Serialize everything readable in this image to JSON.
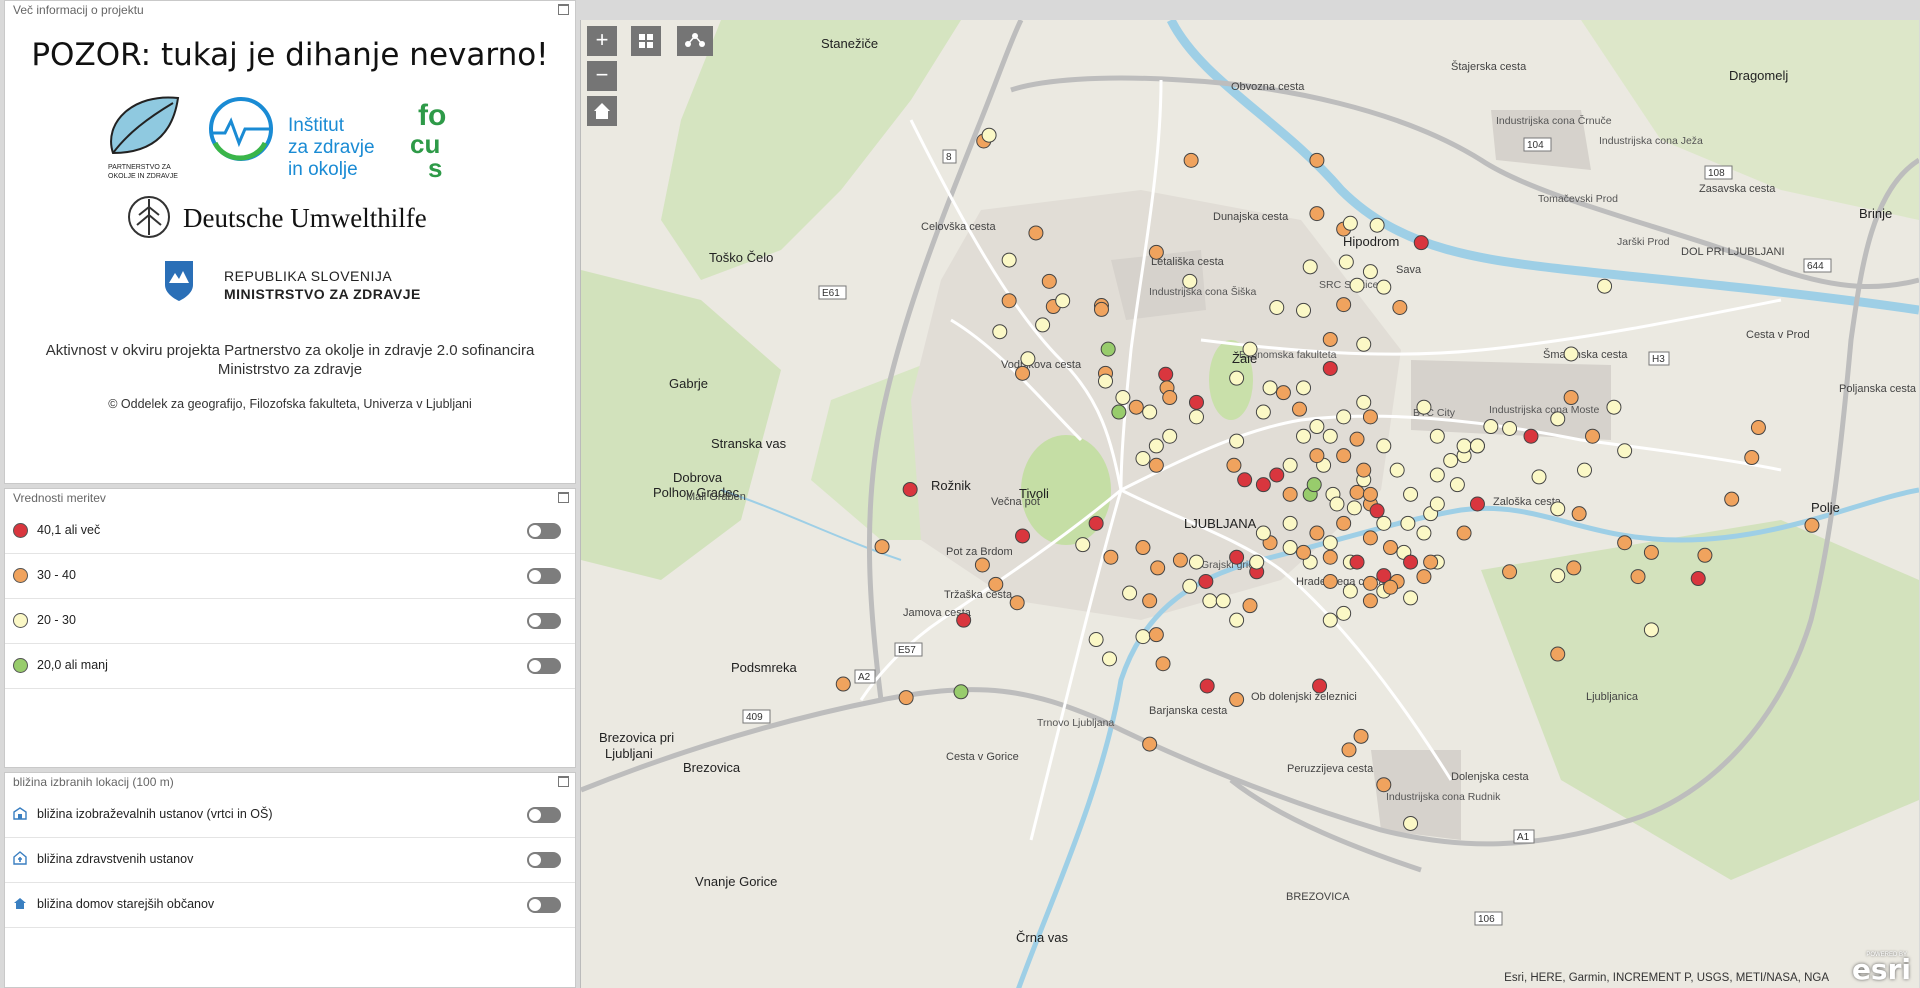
{
  "panel_info": {
    "title": "Več informacij o projektu",
    "headline": "POZOR: tukaj je dihanje nevarno!",
    "logo_pzz": "PARTNERSTVO ZA OKOLJE IN ZDRAVJE",
    "logo_izo": [
      "Inštitut",
      "za zdravje",
      "in okolje"
    ],
    "logo_focus": "FOCUS",
    "logo_duh": "Deutsche Umwelthilfe",
    "logo_rs": [
      "REPUBLIKA SLOVENIJA",
      "MINISTRSTVO ZA ZDRAVJE"
    ],
    "description": "Aktivnost v okviru projekta Partnerstvo za okolje in zdravje 2.0 sofinancira Ministrstvo za zdravje",
    "copyright": "© Oddelek za geografijo, Filozofska fakulteta, Univerza v Ljubljani"
  },
  "panel_legend": {
    "title": "Vrednosti meritev",
    "items": [
      {
        "label": "40,1 ali več",
        "color": "#d9363e"
      },
      {
        "label": "30 - 40",
        "color": "#f0a35e"
      },
      {
        "label": "20 - 30",
        "color": "#fbf8c6"
      },
      {
        "label": "20,0 ali manj",
        "color": "#98cc6c"
      }
    ]
  },
  "panel_proximity": {
    "title": "bližina izbranih lokacij (100 m)",
    "items": [
      {
        "label": "bližina izobraževalnih ustanov (vrtci in OŠ)",
        "icon": "school-icon"
      },
      {
        "label": "bližina zdravstvenih ustanov",
        "icon": "hospital-icon"
      },
      {
        "label": "bližina domov starejših občanov",
        "icon": "home-care-icon"
      }
    ]
  },
  "map": {
    "controls": {
      "zoom_in": "+",
      "zoom_out": "−"
    },
    "attribution": "Esri, HERE, Garmin, INCREMENT P, USGS, METI/NASA, NGA",
    "logo": "esri",
    "logo_powered": "POWERED BY",
    "colors": {
      "land": "#ebe9e1",
      "urban": "#dcd8d2",
      "water": "#9ecfe6",
      "green": "#cfe3b4",
      "road": "#ffffff",
      "highway": "#bdbdbd"
    },
    "places": [
      "Stanežiče",
      "Dragomelj",
      "Brinje",
      "Toško Čelo",
      "Gabrje",
      "Stranska vas",
      "Dobrova",
      "Polhov Gradec",
      "Podsmreka",
      "Brezovica pri",
      "Ljubljani",
      "Brezovica",
      "Vnanje Gorice",
      "Črna vas",
      "Hipodrom",
      "Tivoli",
      "LJUBLJANA",
      "Polje",
      "Industrijska cona Šiška",
      "Industrijska cona Moste",
      "Industrijska cona Rudnik",
      "Industrijska cona Črnuče",
      "Industrijska cona Ježa",
      "Tomačevski Prod",
      "Jarški Prod",
      "Ekonomska fakulteta",
      "Žale",
      "BTC City",
      "Trnovo Ljubljana",
      "SRC Stožice",
      "Grajski grič",
      "Rožnik"
    ],
    "roads": [
      "Obvozna cesta",
      "Zasavska cesta",
      "Celovška cesta",
      "Dunajska cesta",
      "Šmartinska cesta",
      "Zaloška cesta",
      "Hradeckega cesta",
      "Tržaška cesta",
      "Jamova cesta",
      "Barjanska cesta",
      "Dolenjska cesta",
      "Vodnikova cesta",
      "Štajerska cesta",
      "Letališka cesta",
      "Mali Graben",
      "Sava",
      "Ljubljanica",
      "Cesta v Gorice",
      "DOL PRI LJUBLJANI",
      "BREZOVICA",
      "Cesta v Prod",
      "Pot za Brdom",
      "Večna pot",
      "Poljanska cesta",
      "Ob dolenjski železnici",
      "Peruzzijeva cesta"
    ],
    "shields": [
      "A1",
      "A2",
      "E57",
      "E61",
      "H3",
      "104",
      "108",
      "644",
      "409",
      "106",
      "8"
    ],
    "points": [
      [
        0.301,
        0.125,
        2
      ],
      [
        0.305,
        0.119,
        3
      ],
      [
        0.34,
        0.22,
        2
      ],
      [
        0.32,
        0.248,
        3
      ],
      [
        0.32,
        0.29,
        2
      ],
      [
        0.35,
        0.27,
        2
      ],
      [
        0.353,
        0.296,
        2
      ],
      [
        0.36,
        0.29,
        3
      ],
      [
        0.345,
        0.315,
        3
      ],
      [
        0.334,
        0.35,
        3
      ],
      [
        0.313,
        0.322,
        3
      ],
      [
        0.33,
        0.365,
        2
      ],
      [
        0.389,
        0.295,
        2
      ],
      [
        0.389,
        0.299,
        2
      ],
      [
        0.394,
        0.34,
        4
      ],
      [
        0.392,
        0.365,
        2
      ],
      [
        0.392,
        0.373,
        3
      ],
      [
        0.405,
        0.39,
        3
      ],
      [
        0.402,
        0.405,
        4
      ],
      [
        0.415,
        0.4,
        2
      ],
      [
        0.437,
        0.366,
        1
      ],
      [
        0.438,
        0.38,
        2
      ],
      [
        0.425,
        0.405,
        3
      ],
      [
        0.43,
        0.44,
        3
      ],
      [
        0.42,
        0.453,
        3
      ],
      [
        0.43,
        0.46,
        2
      ],
      [
        0.44,
        0.43,
        3
      ],
      [
        0.46,
        0.41,
        3
      ],
      [
        0.49,
        0.37,
        3
      ],
      [
        0.5,
        0.34,
        3
      ],
      [
        0.52,
        0.297,
        3
      ],
      [
        0.54,
        0.3,
        3
      ],
      [
        0.545,
        0.255,
        3
      ],
      [
        0.55,
        0.2,
        2
      ],
      [
        0.57,
        0.216,
        2
      ],
      [
        0.575,
        0.21,
        3
      ],
      [
        0.572,
        0.25,
        3
      ],
      [
        0.58,
        0.274,
        3
      ],
      [
        0.59,
        0.26,
        3
      ],
      [
        0.6,
        0.276,
        3
      ],
      [
        0.56,
        0.33,
        2
      ],
      [
        0.54,
        0.38,
        3
      ],
      [
        0.55,
        0.42,
        3
      ],
      [
        0.555,
        0.46,
        3
      ],
      [
        0.53,
        0.46,
        3
      ],
      [
        0.51,
        0.405,
        3
      ],
      [
        0.49,
        0.435,
        3
      ],
      [
        0.488,
        0.46,
        2
      ],
      [
        0.496,
        0.475,
        1
      ],
      [
        0.51,
        0.48,
        1
      ],
      [
        0.52,
        0.47,
        1
      ],
      [
        0.53,
        0.49,
        2
      ],
      [
        0.545,
        0.49,
        4
      ],
      [
        0.548,
        0.48,
        4
      ],
      [
        0.562,
        0.49,
        3
      ],
      [
        0.565,
        0.5,
        3
      ],
      [
        0.57,
        0.52,
        2
      ],
      [
        0.578,
        0.504,
        3
      ],
      [
        0.58,
        0.488,
        2
      ],
      [
        0.585,
        0.475,
        3
      ],
      [
        0.59,
        0.5,
        2
      ],
      [
        0.595,
        0.507,
        1
      ],
      [
        0.59,
        0.535,
        2
      ],
      [
        0.6,
        0.52,
        3
      ],
      [
        0.605,
        0.545,
        2
      ],
      [
        0.615,
        0.55,
        3
      ],
      [
        0.618,
        0.52,
        3
      ],
      [
        0.635,
        0.51,
        3
      ],
      [
        0.64,
        0.47,
        3
      ],
      [
        0.65,
        0.455,
        3
      ],
      [
        0.66,
        0.45,
        3
      ],
      [
        0.67,
        0.44,
        3
      ],
      [
        0.68,
        0.42,
        3
      ],
      [
        0.694,
        0.422,
        3
      ],
      [
        0.71,
        0.43,
        1
      ],
      [
        0.73,
        0.412,
        3
      ],
      [
        0.74,
        0.39,
        2
      ],
      [
        0.756,
        0.43,
        2
      ],
      [
        0.75,
        0.465,
        3
      ],
      [
        0.67,
        0.5,
        1
      ],
      [
        0.66,
        0.53,
        2
      ],
      [
        0.64,
        0.56,
        3
      ],
      [
        0.62,
        0.56,
        1
      ],
      [
        0.61,
        0.58,
        2
      ],
      [
        0.63,
        0.575,
        2
      ],
      [
        0.6,
        0.59,
        3
      ],
      [
        0.59,
        0.6,
        2
      ],
      [
        0.575,
        0.59,
        3
      ],
      [
        0.56,
        0.58,
        2
      ],
      [
        0.545,
        0.56,
        3
      ],
      [
        0.54,
        0.55,
        2
      ],
      [
        0.53,
        0.545,
        3
      ],
      [
        0.515,
        0.54,
        2
      ],
      [
        0.505,
        0.57,
        1
      ],
      [
        0.49,
        0.555,
        1
      ],
      [
        0.467,
        0.58,
        1
      ],
      [
        0.448,
        0.558,
        2
      ],
      [
        0.42,
        0.545,
        2
      ],
      [
        0.385,
        0.52,
        1
      ],
      [
        0.396,
        0.555,
        2
      ],
      [
        0.41,
        0.592,
        3
      ],
      [
        0.425,
        0.6,
        2
      ],
      [
        0.431,
        0.566,
        2
      ],
      [
        0.46,
        0.56,
        3
      ],
      [
        0.455,
        0.585,
        3
      ],
      [
        0.47,
        0.6,
        3
      ],
      [
        0.48,
        0.6,
        3
      ],
      [
        0.49,
        0.62,
        3
      ],
      [
        0.5,
        0.605,
        2
      ],
      [
        0.505,
        0.56,
        3
      ],
      [
        0.51,
        0.53,
        3
      ],
      [
        0.53,
        0.52,
        3
      ],
      [
        0.55,
        0.53,
        2
      ],
      [
        0.56,
        0.54,
        3
      ],
      [
        0.56,
        0.555,
        2
      ],
      [
        0.575,
        0.56,
        3
      ],
      [
        0.58,
        0.56,
        1
      ],
      [
        0.6,
        0.574,
        1
      ],
      [
        0.56,
        0.62,
        3
      ],
      [
        0.57,
        0.613,
        3
      ],
      [
        0.59,
        0.582,
        2
      ],
      [
        0.605,
        0.586,
        2
      ],
      [
        0.62,
        0.597,
        3
      ],
      [
        0.635,
        0.56,
        2
      ],
      [
        0.63,
        0.53,
        3
      ],
      [
        0.73,
        0.655,
        2
      ],
      [
        0.73,
        0.505,
        3
      ],
      [
        0.746,
        0.51,
        2
      ],
      [
        0.716,
        0.472,
        3
      ],
      [
        0.694,
        0.57,
        2
      ],
      [
        0.73,
        0.574,
        3
      ],
      [
        0.742,
        0.566,
        2
      ],
      [
        0.78,
        0.54,
        2
      ],
      [
        0.8,
        0.55,
        2
      ],
      [
        0.79,
        0.575,
        2
      ],
      [
        0.8,
        0.63,
        3
      ],
      [
        0.835,
        0.577,
        1
      ],
      [
        0.86,
        0.495,
        2
      ],
      [
        0.875,
        0.452,
        2
      ],
      [
        0.88,
        0.421,
        2
      ],
      [
        0.92,
        0.522,
        2
      ],
      [
        0.84,
        0.553,
        2
      ],
      [
        0.3,
        0.563,
        2
      ],
      [
        0.326,
        0.602,
        2
      ],
      [
        0.286,
        0.62,
        1
      ],
      [
        0.284,
        0.694,
        4
      ],
      [
        0.243,
        0.7,
        2
      ],
      [
        0.196,
        0.686,
        2
      ],
      [
        0.246,
        0.485,
        1
      ],
      [
        0.225,
        0.544,
        2
      ],
      [
        0.31,
        0.583,
        2
      ],
      [
        0.33,
        0.533,
        1
      ],
      [
        0.375,
        0.542,
        3
      ],
      [
        0.385,
        0.64,
        3
      ],
      [
        0.395,
        0.66,
        3
      ],
      [
        0.42,
        0.637,
        3
      ],
      [
        0.43,
        0.635,
        2
      ],
      [
        0.435,
        0.665,
        2
      ],
      [
        0.425,
        0.748,
        2
      ],
      [
        0.468,
        0.688,
        1
      ],
      [
        0.49,
        0.702,
        2
      ],
      [
        0.552,
        0.688,
        1
      ],
      [
        0.574,
        0.754,
        2
      ],
      [
        0.583,
        0.74,
        2
      ],
      [
        0.6,
        0.79,
        2
      ],
      [
        0.62,
        0.83,
        3
      ],
      [
        0.456,
        0.145,
        2
      ],
      [
        0.55,
        0.145,
        2
      ],
      [
        0.628,
        0.23,
        1
      ],
      [
        0.595,
        0.212,
        3
      ],
      [
        0.57,
        0.294,
        2
      ],
      [
        0.612,
        0.297,
        2
      ],
      [
        0.66,
        0.44,
        3
      ],
      [
        0.67,
        0.44,
        3
      ],
      [
        0.74,
        0.345,
        3
      ],
      [
        0.765,
        0.275,
        3
      ],
      [
        0.772,
        0.4,
        3
      ],
      [
        0.78,
        0.445,
        3
      ],
      [
        0.585,
        0.335,
        3
      ],
      [
        0.56,
        0.36,
        1
      ],
      [
        0.63,
        0.4,
        3
      ],
      [
        0.64,
        0.43,
        3
      ],
      [
        0.6,
        0.44,
        3
      ],
      [
        0.61,
        0.465,
        3
      ],
      [
        0.58,
        0.433,
        2
      ],
      [
        0.59,
        0.41,
        2
      ],
      [
        0.585,
        0.395,
        3
      ],
      [
        0.57,
        0.41,
        3
      ],
      [
        0.56,
        0.43,
        3
      ],
      [
        0.54,
        0.43,
        3
      ],
      [
        0.55,
        0.45,
        2
      ],
      [
        0.57,
        0.45,
        2
      ],
      [
        0.585,
        0.465,
        2
      ],
      [
        0.59,
        0.49,
        2
      ],
      [
        0.62,
        0.49,
        3
      ],
      [
        0.64,
        0.5,
        3
      ],
      [
        0.655,
        0.48,
        3
      ],
      [
        0.537,
        0.402,
        2
      ],
      [
        0.525,
        0.385,
        2
      ],
      [
        0.515,
        0.38,
        3
      ],
      [
        0.455,
        0.27,
        3
      ],
      [
        0.43,
        0.24,
        2
      ],
      [
        0.44,
        0.39,
        2
      ],
      [
        0.46,
        0.395,
        1
      ]
    ]
  }
}
